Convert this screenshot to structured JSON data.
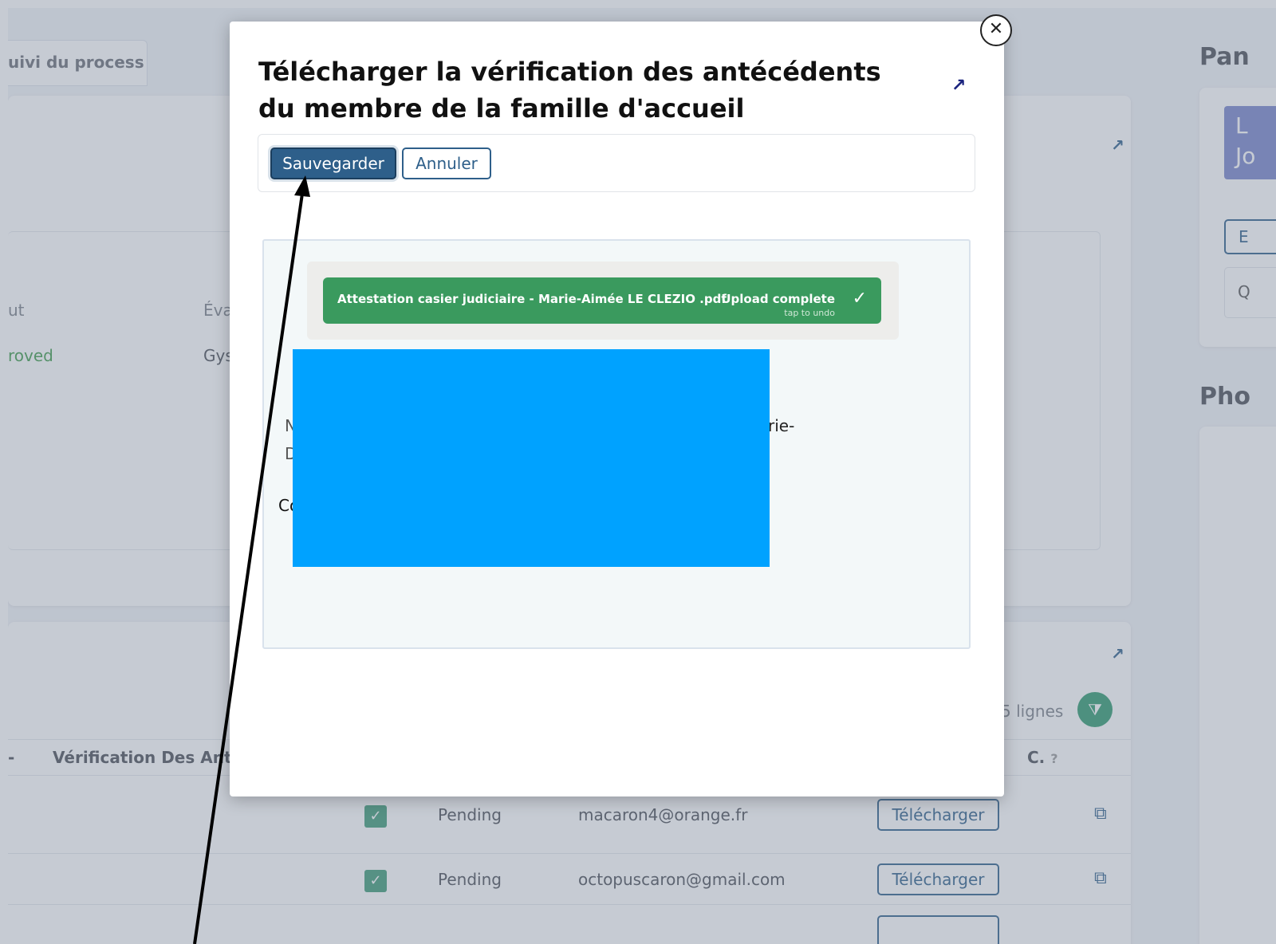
{
  "background": {
    "tab_label": "uivi du process",
    "side_heading_1": "Pan",
    "side_heading_2": "Pho",
    "side_letters_1": "L",
    "side_letters_2": "Jo",
    "side_btn": "E",
    "side_q": "Q",
    "col_status_partial": "ut",
    "col_eval_partial": "Éva",
    "status_value_partial": "roved",
    "eval_value_partial": "Gys",
    "rows_label_partial": "5 lignes",
    "table_dash": "-",
    "table_header_verif": "Vérification Des Anté",
    "table_header_c": "C.",
    "rows": [
      {
        "status": "Pending",
        "email": "macaron4@orange.fr",
        "button": "Télécharger"
      },
      {
        "status": "Pending",
        "email": "octopuscaron@gmail.com",
        "button": "Télécharger"
      }
    ]
  },
  "modal": {
    "title": "Télécharger la vérification des antécédents du membre de la famille d'accueil",
    "save_label": "Sauvegarder",
    "cancel_label": "Annuler",
    "file": {
      "name": "Attestation casier judiciaire - Marie-Aimée LE CLEZIO .pdf",
      "status": "Upload complete",
      "undo": "tap to undo"
    },
    "partial_text_1": "N",
    "partial_text_2": "D",
    "partial_text_3": "Co",
    "partial_text_4": "rie-"
  },
  "colors": {
    "primary": "#2e5f8a",
    "success": "#3a9a5e",
    "redaction": "#00a2ff"
  }
}
